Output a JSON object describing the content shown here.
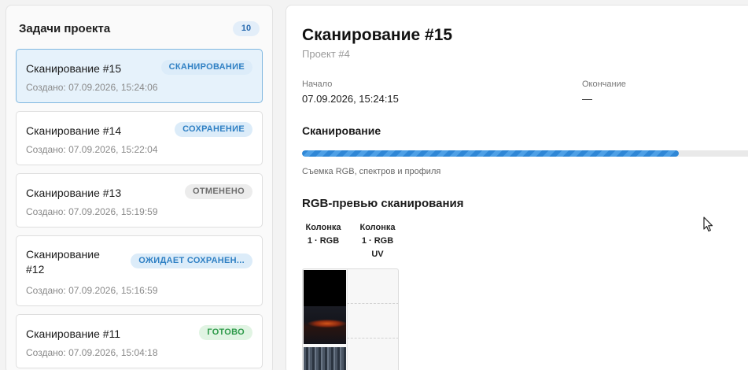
{
  "sidebar": {
    "title": "Задачи проекта",
    "count": "10",
    "tasks": [
      {
        "name": "Сканирование #15",
        "date": "Создано: 07.09.2026, 15:24:06",
        "status": "СКАНИРОВАНИЕ",
        "status_color": "blue",
        "selected": true
      },
      {
        "name": "Сканирование #14",
        "date": "Создано: 07.09.2026, 15:22:04",
        "status": "СОХРАНЕНИЕ",
        "status_color": "blue",
        "selected": false
      },
      {
        "name": "Сканирование #13",
        "date": "Создано: 07.09.2026, 15:19:59",
        "status": "ОТМЕНЕНО",
        "status_color": "gray",
        "selected": false
      },
      {
        "name_line1": "Сканирование",
        "name_line2": "#12",
        "date": "Создано: 07.09.2026, 15:16:59",
        "status": "ОЖИДАЕТ СОХРАНЕН...",
        "status_color": "blue",
        "selected": false
      },
      {
        "name": "Сканирование #11",
        "date": "Создано: 07.09.2026, 15:04:18",
        "status": "ГОТОВО",
        "status_color": "green",
        "selected": false
      }
    ]
  },
  "detail": {
    "title": "Сканирование #15",
    "project": "Проект #4",
    "start_label": "Начало",
    "start_value": "07.09.2026, 15:24:15",
    "end_label": "Окончание",
    "end_value": "—",
    "stage_title": "Сканирование",
    "progress_fraction": 0.84,
    "progress_caption": "Съемка RGB, спектров и профиля",
    "preview_title": "RGB-превью сканирования",
    "columns": [
      {
        "line1": "Колонка",
        "line2": "1 · RGB",
        "line3": ""
      },
      {
        "line1": "Колонка",
        "line2": "1 · RGB",
        "line3": "UV"
      }
    ]
  },
  "colors": {
    "accent": "#2f87d6",
    "selected_bg": "#e6f2fb",
    "pill_blue_text": "#2f80c4",
    "pill_green_text": "#2e9a4a",
    "pill_gray_text": "#6e6e6e"
  },
  "icons": {
    "cursor": "mouse-pointer-icon"
  }
}
